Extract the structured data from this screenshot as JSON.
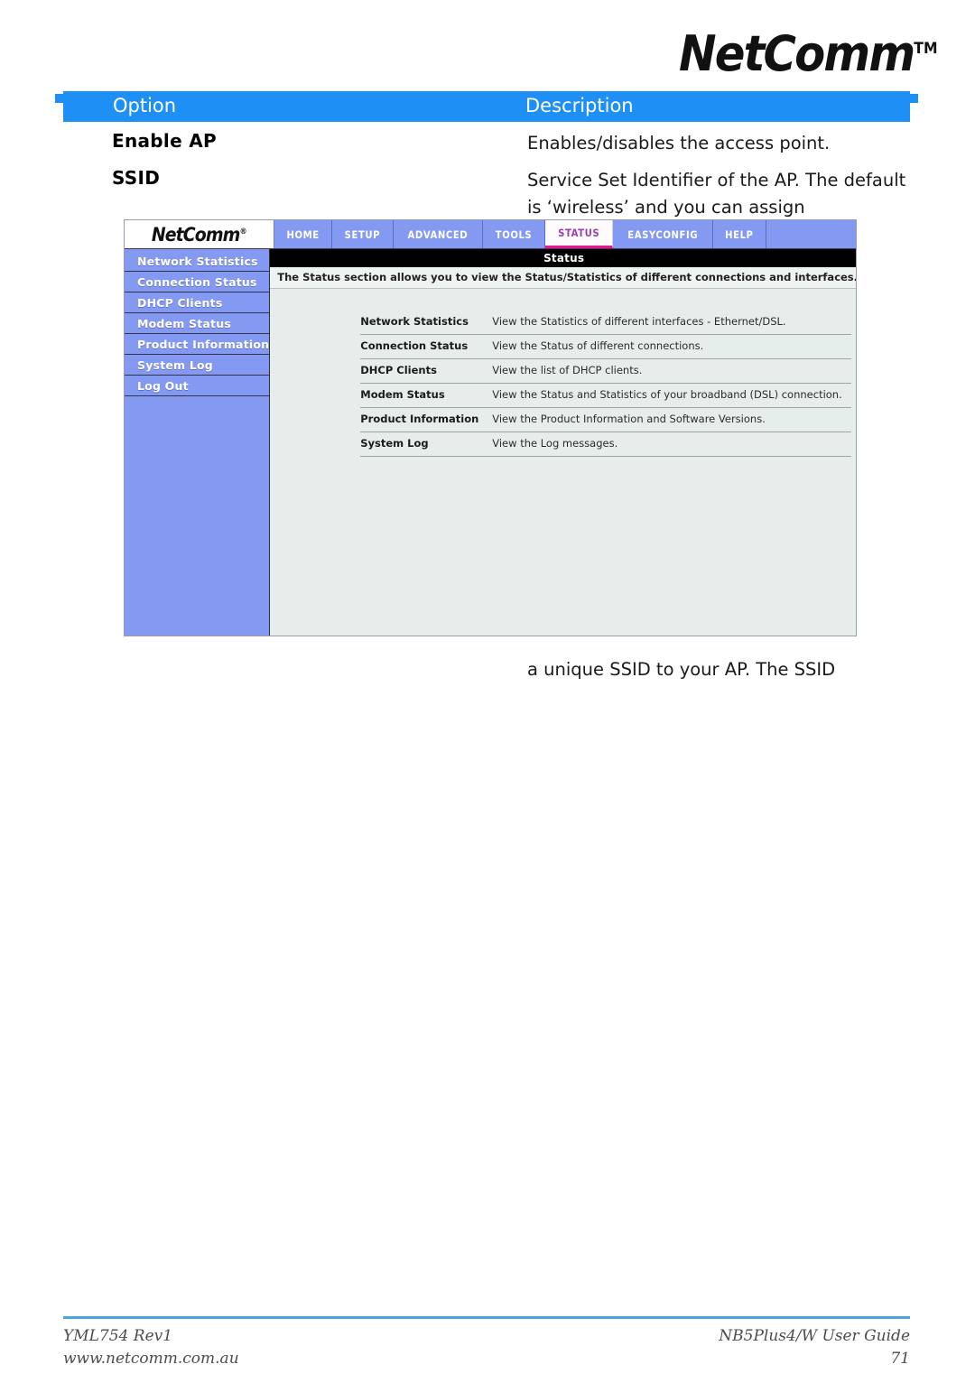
{
  "page": {
    "brand_logo": "NetComm",
    "brand_trademark": "TM"
  },
  "table": {
    "headers": {
      "option": "Option",
      "description": "Description"
    },
    "rows": [
      {
        "term": "Enable AP",
        "description": "Enables/disables the access point."
      },
      {
        "term": "SSID",
        "description": "Service Set Identifier of the AP. The default is ‘wireless’ and you can assign",
        "description_continued": "a unique SSID to your AP.  The SSID"
      }
    ]
  },
  "router_screenshot": {
    "brand": "NetComm",
    "brand_registered": "®",
    "nav_tabs": [
      {
        "label": "HOME",
        "active": false
      },
      {
        "label": "SETUP",
        "active": false
      },
      {
        "label": "ADVANCED",
        "active": false
      },
      {
        "label": "TOOLS",
        "active": false
      },
      {
        "label": "STATUS",
        "active": true
      },
      {
        "label": "EASYCONFIG",
        "active": false
      },
      {
        "label": "HELP",
        "active": false
      }
    ],
    "sidebar": [
      {
        "label": "Network Statistics"
      },
      {
        "label": "Connection Status"
      },
      {
        "label": "DHCP Clients"
      },
      {
        "label": "Modem Status"
      },
      {
        "label": "Product Information"
      },
      {
        "label": "System Log"
      },
      {
        "label": "Log Out"
      }
    ],
    "panel": {
      "title": "Status",
      "subtitle": "The Status section allows you to view the Status/Statistics of different connections and interfaces.",
      "items": [
        {
          "key": "Network Statistics",
          "value": "View the Statistics of different interfaces - Ethernet/DSL."
        },
        {
          "key": "Connection Status",
          "value": "View the Status of different connections."
        },
        {
          "key": "DHCP Clients",
          "value": "View the list of DHCP clients."
        },
        {
          "key": "Modem Status",
          "value": "View the Status and Statistics of your broadband (DSL) connection."
        },
        {
          "key": "Product Information",
          "value": "View the Product Information and Software Versions."
        },
        {
          "key": "System Log",
          "value": "View the Log messages."
        }
      ]
    },
    "colors": {
      "nav_blue": "#8399f2",
      "active_tab_text": "#9c3fb5",
      "active_tab_underline": "#e8158e",
      "panel_background": "#e7edea"
    }
  },
  "footer": {
    "doc_code": "YML754 Rev1",
    "website": "www.netcomm.com.au",
    "guide_title": "NB5Plus4/W User Guide",
    "page_number": "71",
    "rule_color": "#4da2e0"
  }
}
